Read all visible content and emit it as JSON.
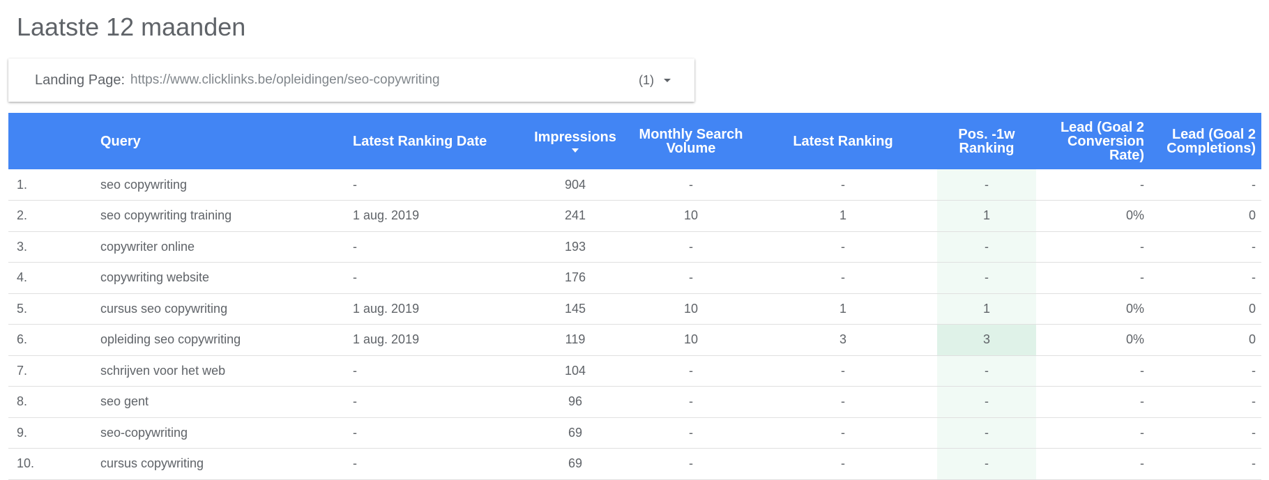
{
  "page": {
    "title": "Laatste 12 maanden"
  },
  "filter": {
    "label": "Landing Page:",
    "value": "https://www.clicklinks.be/opleidingen/seo-copywriting",
    "count": "(1)"
  },
  "table": {
    "headers": [
      "",
      "Query",
      "Latest Ranking Date",
      "Impressions",
      "Monthly Search Volume",
      "Latest Ranking",
      "Pos. -1w Ranking",
      "Lead (Goal 2 Conversion Rate)",
      "Lead (Goal 2 Completions)"
    ],
    "sort_column": "Impressions",
    "rows": [
      {
        "idx": "1.",
        "query": "seo copywriting",
        "date": "-",
        "impressions": "904",
        "volume": "-",
        "ranking": "-",
        "pos1w": "-",
        "conv_rate": "-",
        "completions": "-"
      },
      {
        "idx": "2.",
        "query": "seo copywriting training",
        "date": "1 aug. 2019",
        "impressions": "241",
        "volume": "10",
        "ranking": "1",
        "pos1w": "1",
        "conv_rate": "0%",
        "completions": "0"
      },
      {
        "idx": "3.",
        "query": "copywriter online",
        "date": "-",
        "impressions": "193",
        "volume": "-",
        "ranking": "-",
        "pos1w": "-",
        "conv_rate": "-",
        "completions": "-"
      },
      {
        "idx": "4.",
        "query": "copywriting website",
        "date": "-",
        "impressions": "176",
        "volume": "-",
        "ranking": "-",
        "pos1w": "-",
        "conv_rate": "-",
        "completions": "-"
      },
      {
        "idx": "5.",
        "query": "cursus seo copywriting",
        "date": "1 aug. 2019",
        "impressions": "145",
        "volume": "10",
        "ranking": "1",
        "pos1w": "1",
        "conv_rate": "0%",
        "completions": "0"
      },
      {
        "idx": "6.",
        "query": "opleiding seo copywriting",
        "date": "1 aug. 2019",
        "impressions": "119",
        "volume": "10",
        "ranking": "3",
        "pos1w": "3",
        "conv_rate": "0%",
        "completions": "0"
      },
      {
        "idx": "7.",
        "query": "schrijven voor het web",
        "date": "-",
        "impressions": "104",
        "volume": "-",
        "ranking": "-",
        "pos1w": "-",
        "conv_rate": "-",
        "completions": "-"
      },
      {
        "idx": "8.",
        "query": "seo gent",
        "date": "-",
        "impressions": "96",
        "volume": "-",
        "ranking": "-",
        "pos1w": "-",
        "conv_rate": "-",
        "completions": "-"
      },
      {
        "idx": "9.",
        "query": "seo-copywriting",
        "date": "-",
        "impressions": "69",
        "volume": "-",
        "ranking": "-",
        "pos1w": "-",
        "conv_rate": "-",
        "completions": "-"
      },
      {
        "idx": "10.",
        "query": "cursus copywriting",
        "date": "-",
        "impressions": "69",
        "volume": "-",
        "ranking": "-",
        "pos1w": "-",
        "conv_rate": "-",
        "completions": "-"
      }
    ]
  },
  "colors": {
    "header_bg": "#4285f4",
    "heat_low": "#f1faf5",
    "heat_high": "#dff2e8"
  }
}
